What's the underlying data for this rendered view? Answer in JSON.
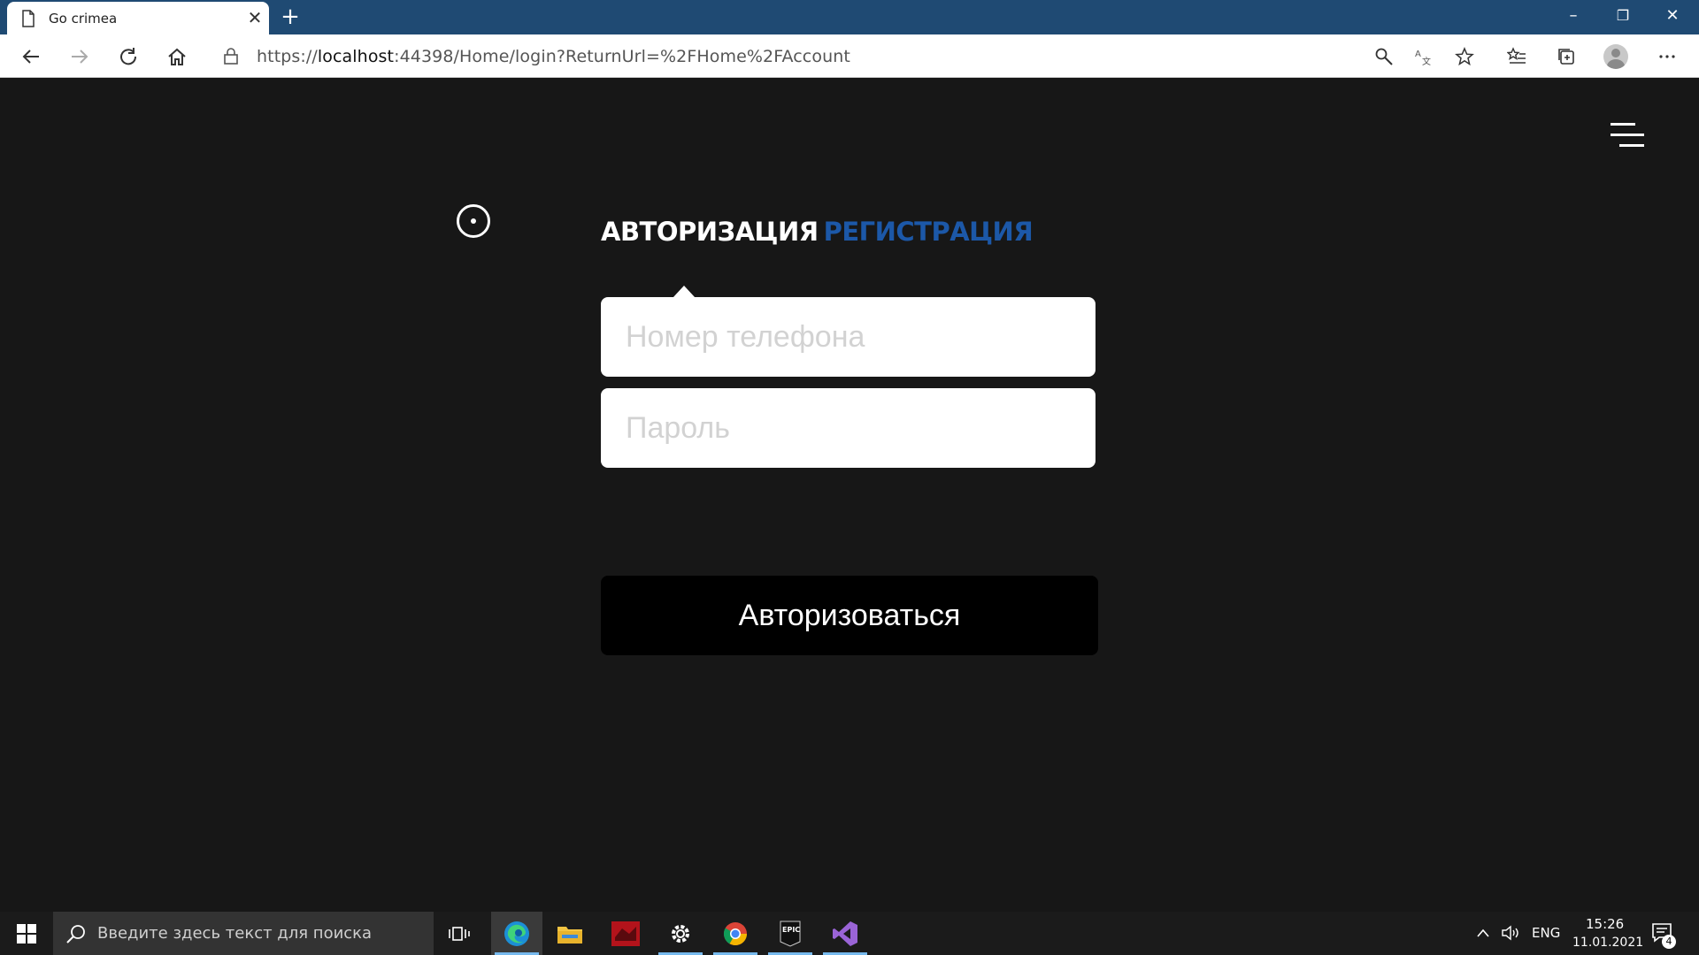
{
  "browser": {
    "tab": {
      "title": "Go crimea",
      "close": "✕"
    },
    "new_tab": "+",
    "window_controls": {
      "minimize": "–",
      "restore": "❐",
      "close": "✕"
    },
    "url": {
      "scheme": "https://",
      "host": "localhost",
      "rest": ":44398/Home/login?ReturnUrl=%2FHome%2FAccount"
    }
  },
  "page": {
    "auth_tabs": {
      "login": "АВТОРИЗАЦИЯ",
      "register": "РЕГИСТРАЦИЯ",
      "active": "login"
    },
    "phone_field": {
      "placeholder": "Номер телефона",
      "value": ""
    },
    "password_field": {
      "placeholder": "Пароль",
      "value": ""
    },
    "submit_label": "Авторизоваться",
    "colors": {
      "background": "#171717",
      "active_tab": "#ffffff",
      "inactive_tab": "#1c58a8",
      "button": "#000000"
    }
  },
  "taskbar": {
    "search_placeholder": "Введите здесь текст для поиска",
    "apps": [
      "task-view-icon",
      "edge-icon",
      "file-explorer-icon",
      "game-app-icon",
      "settings-icon",
      "chrome-icon",
      "epic-games-icon",
      "visual-studio-icon"
    ],
    "language": "ENG",
    "time": "15:26",
    "date": "11.01.2021",
    "notifications": "4"
  }
}
